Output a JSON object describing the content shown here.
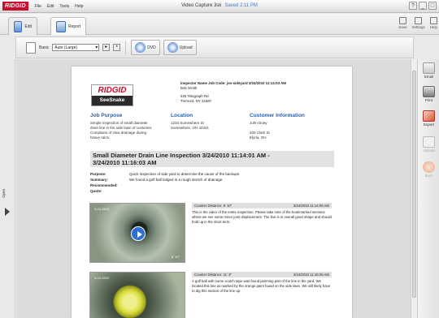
{
  "app": {
    "logo": "RIDGID",
    "menu": [
      "File",
      "Edit",
      "Tools",
      "Help"
    ],
    "title": "Video Capture 3sk",
    "saved": "Saved 2:11 PM",
    "window_buttons": [
      "?",
      "_",
      "□"
    ]
  },
  "tabs": [
    {
      "label": "Edit"
    },
    {
      "label": "Report"
    }
  ],
  "right_tools": [
    {
      "label": "Save"
    },
    {
      "label": "Settings"
    },
    {
      "label": "Help"
    }
  ],
  "toolbar": {
    "template_label": "Basic",
    "template_value": "Auto (Large)",
    "dvd_label": "DVD",
    "upload_label": "Upload"
  },
  "side": {
    "open_label": "Open"
  },
  "right_panel": [
    {
      "label": "Email",
      "enabled": true
    },
    {
      "label": "Print",
      "enabled": true
    },
    {
      "label": "Export",
      "enabled": true
    },
    {
      "label": "Upload",
      "enabled": false
    },
    {
      "label": "Burn",
      "enabled": false
    }
  ],
  "report": {
    "logo_top": "RIDGID",
    "logo_bottom": "SeeSnake",
    "inspector_line": "Inspector Name   Job Code:  jsn-sideyard    3/24/2010 11:14:03 AM",
    "inspector_name": "Bob Smith",
    "address_1": "525 Telegraph Rd",
    "address_2": "Tremont, NY 21587",
    "sections": [
      {
        "heading": "Job Purpose",
        "lines": [
          "Simple inspection of small diameter",
          "drain line in the side lawn of customer.",
          "Complains of slow drainage during",
          "heavy rains."
        ]
      },
      {
        "heading": "Location",
        "lines": [
          "1234 Somewhere St",
          "Somewhere, OH 42341"
        ]
      },
      {
        "heading": "Customer Information",
        "lines": [
          "John Doey",
          "",
          "400 Clark St",
          "Elyria, OH"
        ]
      }
    ],
    "inspection_title": "Small Diameter Drain Line Inspection  3/24/2010 11:14:01 AM  -",
    "inspection_title_2": "3/24/2010 11:16:03 AM",
    "fields": [
      {
        "label": "Purpose:",
        "value": "Quick inspection of side yard to determine the cause of the backups"
      },
      {
        "label": "Summary:",
        "value": "We found a golf ball lodged in a rough stretch of drainage."
      },
      {
        "label": "Recommended:",
        "value": ""
      },
      {
        "label": "Quote:",
        "value": ""
      }
    ],
    "entries": [
      {
        "stamp": "3-24-2010",
        "distance_overlay": "8' 10\"",
        "counter_label": "Counter Distance:",
        "counter_value": "8' 10\"",
        "timestamp": "3/24/2010 11:14:09 AM",
        "text": "This is the video of the entire inspection. Please take note of the bookmarked sections where we see some minor joint displacement. The line is in overall good shape and should hold up in the short term."
      },
      {
        "stamp": "3-24-2010",
        "distance_overlay": "",
        "counter_label": "Counter Distance:",
        "counter_value": "11' 3\"",
        "timestamp": "3/24/2010 11:15:36 AM",
        "text": "A golf ball with some scotch tape was found jamming part of the line in the yard. We located this line as marked by the orange paint found on the side lawn. We will likely have to dig this section of the line up."
      }
    ]
  },
  "colors": {
    "brand_red": "#c8102e",
    "section_blue": "#2c5fa8",
    "play_blue": "#2e6ed1"
  }
}
